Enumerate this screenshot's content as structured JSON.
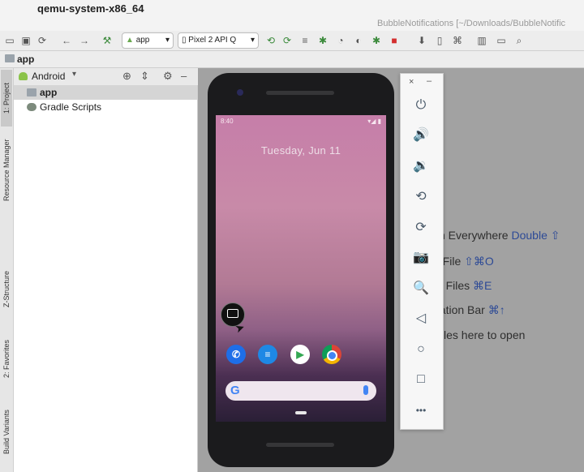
{
  "menubar": {
    "app_name": "qemu-system-x86_64",
    "apple_glyph": ""
  },
  "window": {
    "title": "BubbleNotifications [~/Downloads/BubbleNotific"
  },
  "toolbar": {
    "run_config": "app",
    "device": "Pixel 2 API Q"
  },
  "breadcrumb": {
    "label": "app"
  },
  "left_tabs": [
    "1: Project",
    "Resource Manager",
    "Z-Structure",
    "2: Favorites",
    "Build Variants"
  ],
  "project": {
    "view_mode": "Android",
    "tree": [
      {
        "label": "app",
        "selected": true
      },
      {
        "label": "Gradle Scripts",
        "selected": false
      }
    ]
  },
  "editor_hints": [
    {
      "text": "ch Everywhere ",
      "key": "Double ⇧"
    },
    {
      "text": "o File ",
      "key": "⇧⌘O"
    },
    {
      "text": "nt Files ",
      "key": "⌘E"
    },
    {
      "text": "gation Bar ",
      "key": "⌘↑"
    },
    {
      "text": " files here to open",
      "key": ""
    }
  ],
  "phone": {
    "status_time": "8:40",
    "status_right": "▾◢ ▮",
    "date": "Tuesday, Jun 11",
    "search_glyph": "G"
  },
  "emulator_toolbar": {
    "close": "×",
    "minimize": "–",
    "buttons": [
      {
        "icon": "power-icon",
        "glyph": "⏻"
      },
      {
        "icon": "volume-up-icon",
        "glyph": "🔊"
      },
      {
        "icon": "volume-down-icon",
        "glyph": "🔉"
      },
      {
        "icon": "rotate-left-icon",
        "glyph": "⟲"
      },
      {
        "icon": "rotate-right-icon",
        "glyph": "⟳"
      },
      {
        "icon": "camera-icon",
        "glyph": "📷"
      },
      {
        "icon": "zoom-icon",
        "glyph": "🔍"
      },
      {
        "icon": "back-icon",
        "glyph": "◁"
      },
      {
        "icon": "home-icon",
        "glyph": "○"
      },
      {
        "icon": "overview-icon",
        "glyph": "□"
      },
      {
        "icon": "more-icon",
        "glyph": "•••"
      }
    ]
  },
  "colors": {
    "editor_bg": "#a2a2a2",
    "shortcut_key": "#2d4a96",
    "selected_row": "#d5d5d5"
  }
}
